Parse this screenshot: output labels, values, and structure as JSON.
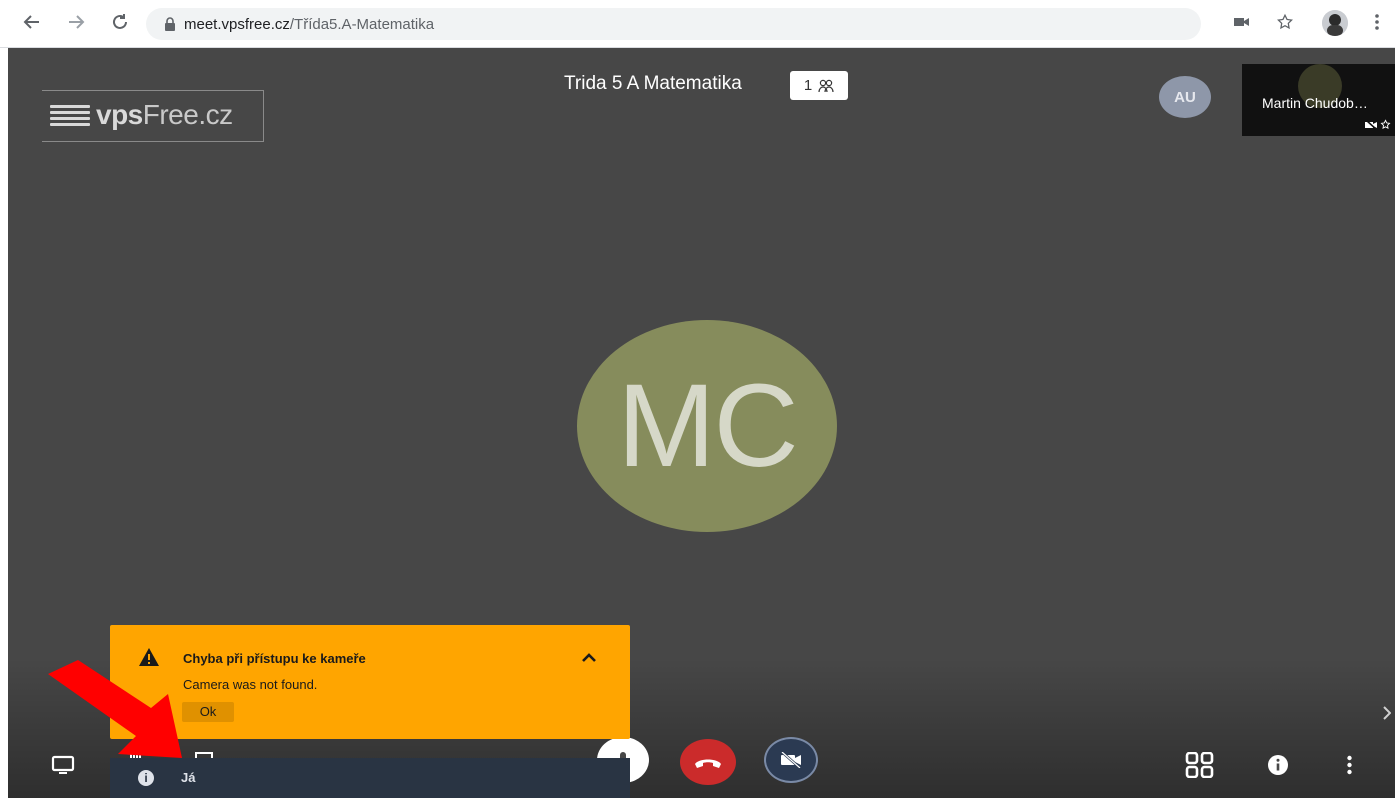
{
  "browser": {
    "url_host": "meet.vpsfree.cz",
    "url_path": "/Třída5.A-Matematika",
    "icons": {
      "back": "arrow-left-icon",
      "forward": "arrow-right-icon",
      "reload": "reload-icon",
      "lock": "lock-icon",
      "camera": "camera-icon",
      "bookmark": "star-icon",
      "profile": "profile-avatar",
      "menu": "kebab-menu-icon"
    }
  },
  "meeting": {
    "logo_bold": "vps",
    "logo_light": "Free.cz",
    "title": "Trida 5 A Matematika",
    "participant_count": "1",
    "au_initials": "AU",
    "main_initials": "MC",
    "thumbnail_name": "Martin Chudob…"
  },
  "notification": {
    "title": "Chyba při přístupu ke kameře",
    "message": "Camera was not found.",
    "ok_label": "Ok"
  },
  "chat": {
    "label": "Já"
  },
  "colors": {
    "stage_bg": "#474747",
    "notice_bg": "#ffa500",
    "hangup_red": "#cb2b2b",
    "avatar_main": "#868c5c",
    "avatar_au": "#8e97a9",
    "arrow_red": "#ff0000"
  }
}
